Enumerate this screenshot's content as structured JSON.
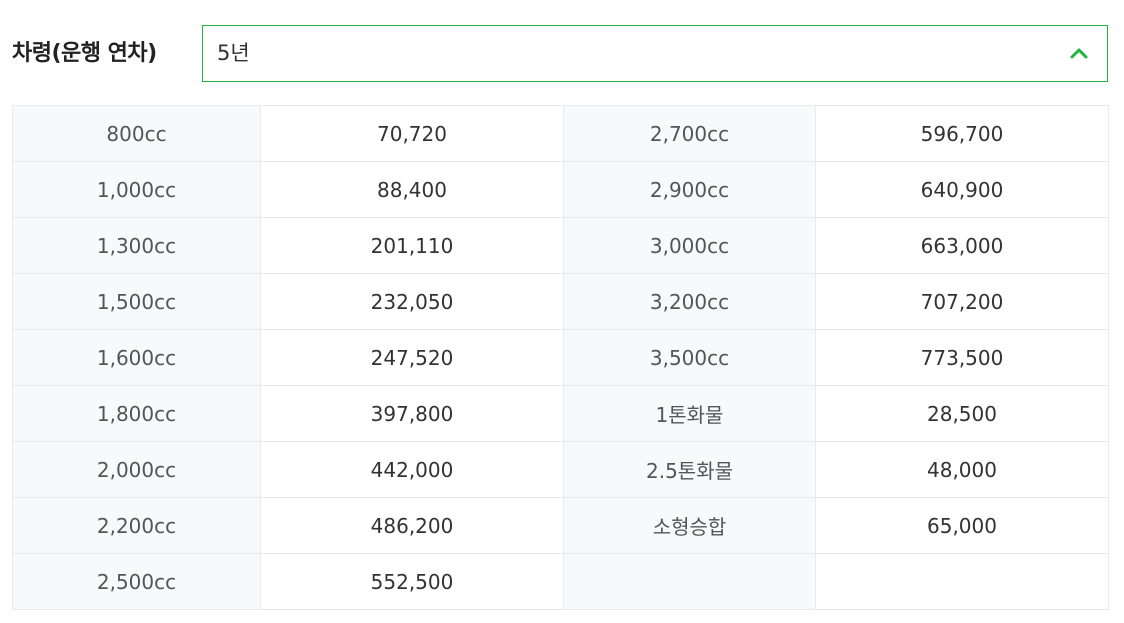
{
  "filter": {
    "label": "차령(운행 연차)",
    "selected_value": "5년",
    "icon": "chevron-up-icon",
    "accent_color": "#1eb53a"
  },
  "table": {
    "rows": [
      {
        "k1": "800cc",
        "v1": "70,720",
        "k2": "2,700cc",
        "v2": "596,700"
      },
      {
        "k1": "1,000cc",
        "v1": "88,400",
        "k2": "2,900cc",
        "v2": "640,900"
      },
      {
        "k1": "1,300cc",
        "v1": "201,110",
        "k2": "3,000cc",
        "v2": "663,000"
      },
      {
        "k1": "1,500cc",
        "v1": "232,050",
        "k2": "3,200cc",
        "v2": "707,200"
      },
      {
        "k1": "1,600cc",
        "v1": "247,520",
        "k2": "3,500cc",
        "v2": "773,500"
      },
      {
        "k1": "1,800cc",
        "v1": "397,800",
        "k2": "1톤화물",
        "v2": "28,500"
      },
      {
        "k1": "2,000cc",
        "v1": "442,000",
        "k2": "2.5톤화물",
        "v2": "48,000"
      },
      {
        "k1": "2,200cc",
        "v1": "486,200",
        "k2": "소형승합",
        "v2": "65,000"
      },
      {
        "k1": "2,500cc",
        "v1": "552,500",
        "k2": "",
        "v2": ""
      }
    ]
  }
}
